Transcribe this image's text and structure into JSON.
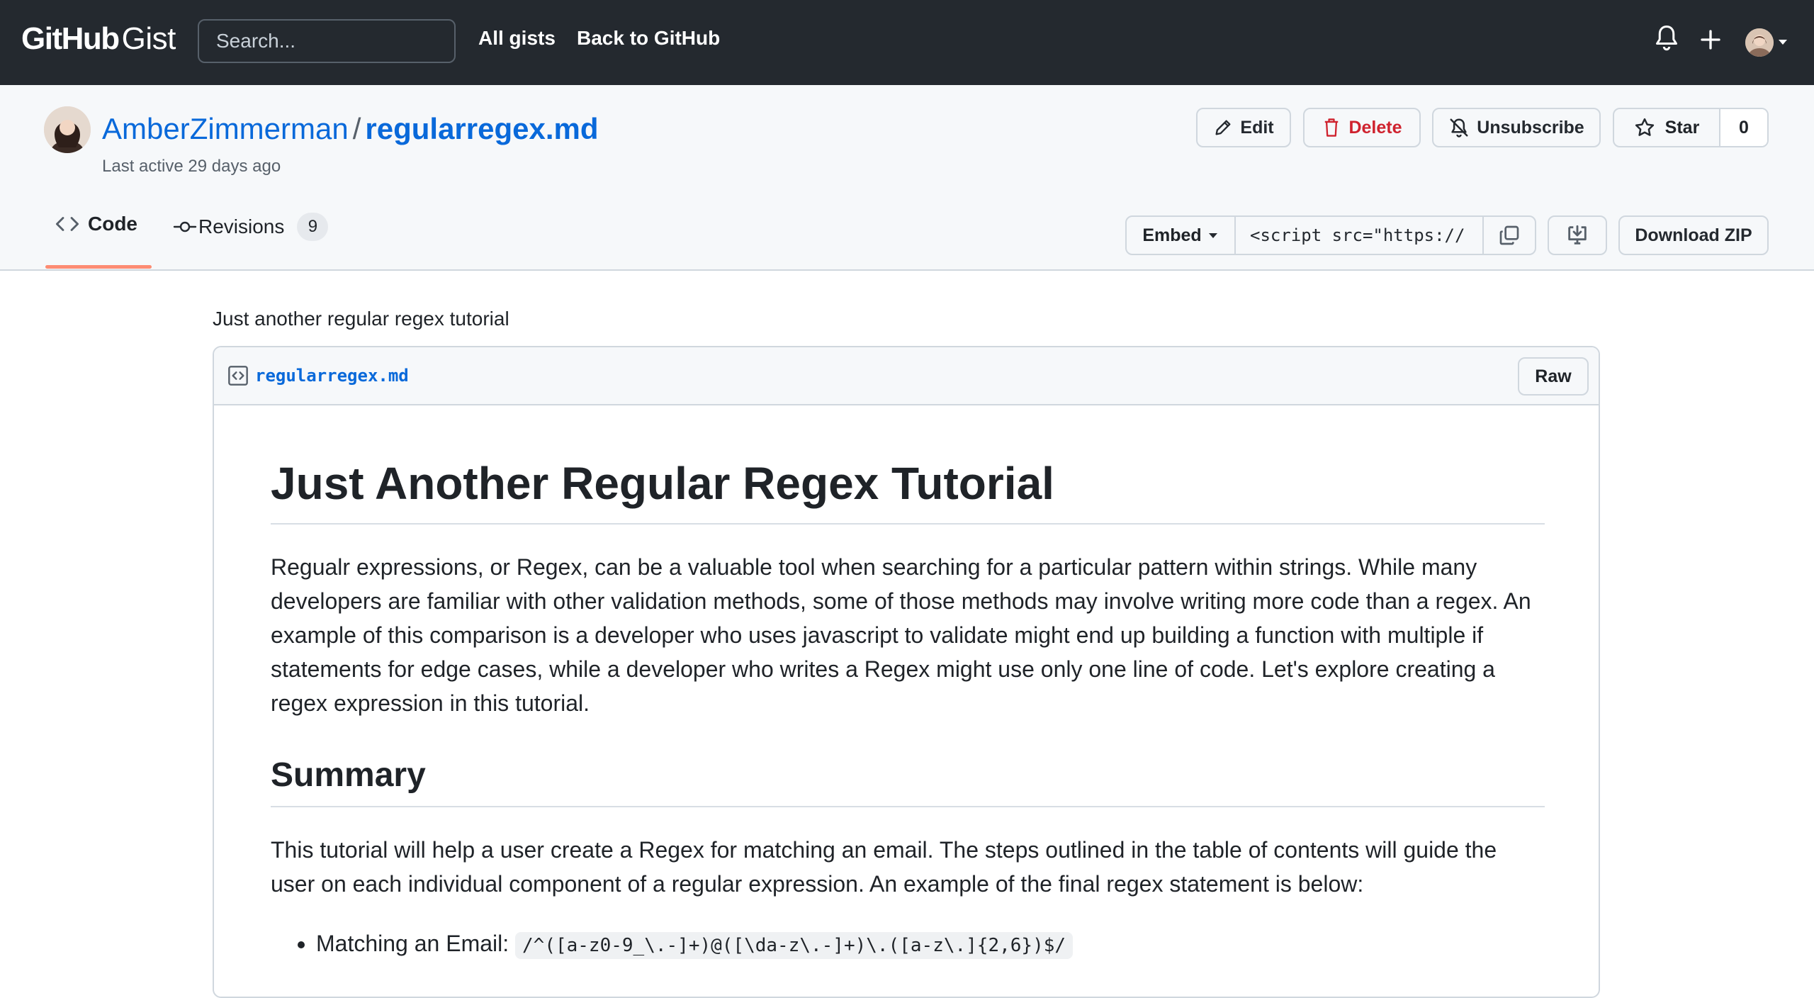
{
  "header": {
    "logo_bold": "GitHub",
    "logo_light": "Gist",
    "search_placeholder": "Search...",
    "nav": [
      "All gists",
      "Back to GitHub"
    ],
    "icons": [
      "bell-icon",
      "plus-icon",
      "avatar-dropdown"
    ]
  },
  "gist": {
    "owner": "AmberZimmerman",
    "separator": "/",
    "filename": "regularregex.md",
    "last_active": "Last active 29 days ago",
    "actions": {
      "edit": "Edit",
      "delete": "Delete",
      "unsubscribe": "Unsubscribe",
      "star": "Star",
      "star_count": "0"
    },
    "tabs": {
      "code": "Code",
      "revisions": "Revisions",
      "revisions_count": "9"
    },
    "embed": {
      "label": "Embed",
      "value": "<script src=\"https://"
    },
    "download_zip": "Download ZIP",
    "description": "Just another regular regex tutorial"
  },
  "file": {
    "name": "regularregex.md",
    "raw_label": "Raw",
    "content": {
      "h1": "Just Another Regular Regex Tutorial",
      "intro": "Regualr expressions, or Regex, can be a valuable tool when searching for a particular pattern within strings. While many developers are familiar with other validation methods, some of those methods may involve writing more code than a regex. An example of this comparison is a developer who uses javascript to validate might end up building a function with multiple if statements for edge cases, while a developer who writes a Regex might use only one line of code. Let's explore creating a regex expression in this tutorial.",
      "h2": "Summary",
      "summary": "This tutorial will help a user create a Regex for matching an email. The steps outlined in the table of contents will guide the user on each individual component of a regular expression. An example of the final regex statement is below:",
      "list_label": "Matching an Email:",
      "list_code": "/^([a-z0-9_\\.-]+)@([\\da-z\\.-]+)\\.([a-z\\.]{2,6})$/"
    }
  },
  "colors": {
    "header_bg": "#24292f",
    "link": "#0969da",
    "danger": "#cf222e",
    "tab_underline": "#fd8c73",
    "subtle_bg": "#f6f8fa",
    "border": "#d0d7de"
  }
}
